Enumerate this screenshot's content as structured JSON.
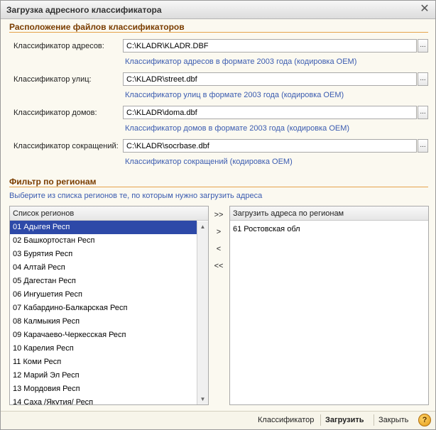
{
  "window": {
    "title": "Загрузка адресного классификатора",
    "close": "✕"
  },
  "files_section": {
    "title": "Расположение файлов классификаторов",
    "rows": [
      {
        "label": "Классификатор адресов:",
        "value": "C:\\KLADR\\KLADR.DBF",
        "hint": "Классификатор адресов в формате  2003 года  (кодировка OEM)"
      },
      {
        "label": "Классификатор улиц:",
        "value": "C:\\KLADR\\street.dbf",
        "hint": "Классификатор улиц в формате  2003 года  (кодировка OEM)"
      },
      {
        "label": "Классификатор домов:",
        "value": "C:\\KLADR\\doma.dbf",
        "hint": "Классификатор домов в формате  2003 года  (кодировка OEM)"
      },
      {
        "label": "Классификатор сокращений:",
        "value": "C:\\KLADR\\socrbase.dbf",
        "hint": "Классификатор сокращений (кодировка OEM)"
      }
    ],
    "browse": "..."
  },
  "filter_section": {
    "title": "Фильтр по регионам",
    "hint": "Выберите из списка регионов те, по которым нужно загрузить адреса"
  },
  "regions_list": {
    "header": "Список регионов",
    "items": [
      "01 Адыгея Респ",
      "02 Башкортостан Респ",
      "03 Бурятия Респ",
      "04 Алтай Респ",
      "05 Дагестан Респ",
      "06 Ингушетия Респ",
      "07 Кабардино-Балкарская Респ",
      "08 Калмыкия Респ",
      "09 Карачаево-Черкесская Респ",
      "10 Карелия Респ",
      "11 Коми Респ",
      "12 Марий Эл Респ",
      "13 Мордовия Респ",
      "14 Саха /Якутия/ Респ"
    ]
  },
  "move_buttons": {
    "add_all": ">>",
    "add": ">",
    "remove": "<",
    "remove_all": "<<"
  },
  "selected_list": {
    "header": "Загрузить адреса по регионам",
    "items": [
      "61 Ростовская обл"
    ]
  },
  "footer": {
    "classifier": "Классификатор",
    "load": "Загрузить",
    "close": "Закрыть",
    "help": "?"
  }
}
